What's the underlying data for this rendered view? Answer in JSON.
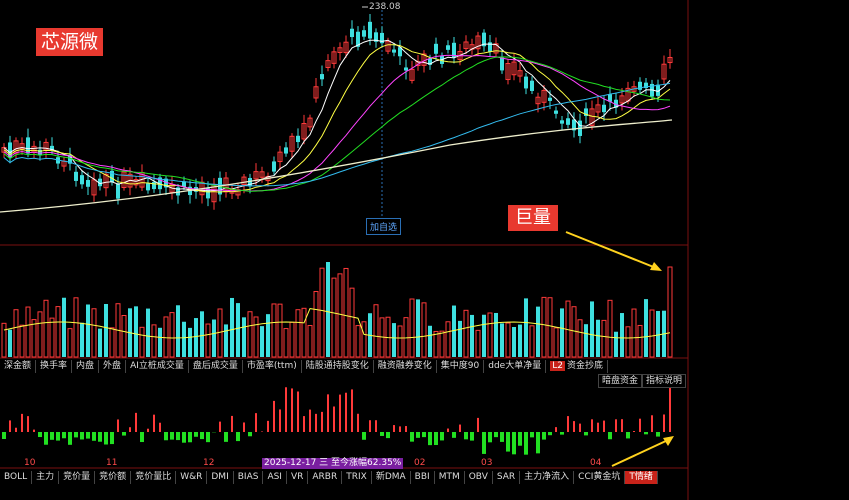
{
  "stock": {
    "name": "芯源微"
  },
  "annotation": {
    "volume_tag": "巨量"
  },
  "price": {
    "high_label": "238.08",
    "tip": "加自选"
  },
  "indicator_tabs": [
    {
      "label": "深金额"
    },
    {
      "label": "换手率"
    },
    {
      "label": "内盘"
    },
    {
      "label": "外盘"
    },
    {
      "label": "AI立桩成交量"
    },
    {
      "label": "盘后成交量"
    },
    {
      "label": "市盈率(ttm)"
    },
    {
      "label": "陆股通持股变化"
    },
    {
      "label": "融资融券变化"
    },
    {
      "label": "集中度90"
    },
    {
      "label": "dde大单净量"
    },
    {
      "label": "资金抄底",
      "badge": "L2"
    }
  ],
  "side_buttons": {
    "dark_fund": "暗盘资金",
    "indicator_help": "指标说明"
  },
  "bottom_tabs": [
    {
      "label": "BOLL"
    },
    {
      "label": "主力"
    },
    {
      "label": "竞价量"
    },
    {
      "label": "竞价额"
    },
    {
      "label": "竞价量比"
    },
    {
      "label": "W&R"
    },
    {
      "label": "DMI"
    },
    {
      "label": "BIAS"
    },
    {
      "label": "ASI"
    },
    {
      "label": "VR"
    },
    {
      "label": "ARBR"
    },
    {
      "label": "TRIX"
    },
    {
      "label": "新DMA"
    },
    {
      "label": "BBI"
    },
    {
      "label": "MTM"
    },
    {
      "label": "OBV"
    },
    {
      "label": "SAR"
    },
    {
      "label": "主力净流入"
    },
    {
      "label": "CCI黄金坑"
    },
    {
      "label": "T情绪",
      "active": true
    }
  ],
  "dates": {
    "d1": "10",
    "d2": "11",
    "d3": "12",
    "d4": "02",
    "d5": "03",
    "d6": "04",
    "highlight": "2025-12-17 三 至今涨幅62.35%"
  },
  "colors": {
    "up": "#ff3a3a",
    "down": "#3ee0e0",
    "green": "#22e022",
    "ma5": "#ffffff",
    "ma10": "#ffff44",
    "ma20": "#ff44ff",
    "ma30": "#22dd22",
    "ma60": "#33bbee",
    "ma120": "#eeeecc"
  }
}
